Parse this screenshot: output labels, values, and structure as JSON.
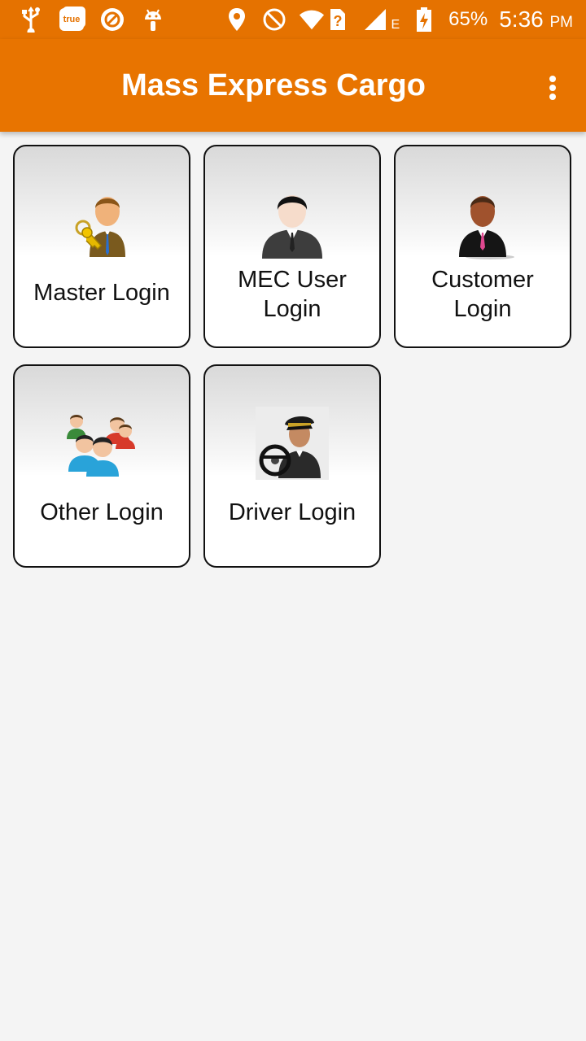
{
  "status_bar": {
    "carrier_badge": "true",
    "network_type": "E",
    "battery_percent": "65%",
    "time": "5:36",
    "time_suffix": "PM",
    "icons": [
      "usb-icon",
      "true-app-icon",
      "blocked-icon",
      "android-icon",
      "location-icon",
      "do-not-disturb-icon",
      "wifi-icon",
      "signal-icon",
      "battery-charging-icon"
    ]
  },
  "app_bar": {
    "title": "Mass Express Cargo",
    "menu_icon": "overflow-menu-icon"
  },
  "tiles": [
    {
      "label": "Master Login",
      "icon": "master-keys-user-icon"
    },
    {
      "label": "MEC User Login",
      "icon": "business-user-icon"
    },
    {
      "label": "Customer Login",
      "icon": "customer-user-icon"
    },
    {
      "label": "Other Login",
      "icon": "group-users-icon"
    },
    {
      "label": "Driver Login",
      "icon": "driver-steering-icon"
    }
  ],
  "colors": {
    "status_bar": "#e57200",
    "app_bar": "#e87400",
    "background": "#f4f4f4"
  }
}
